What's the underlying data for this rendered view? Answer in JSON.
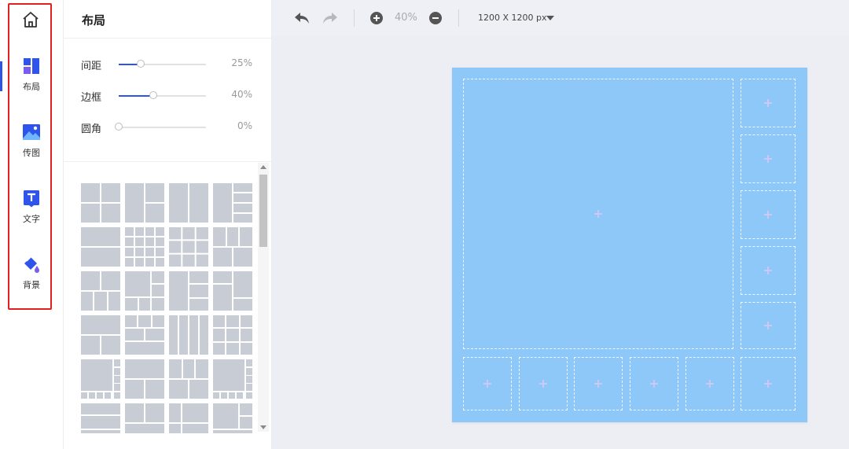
{
  "rail": {
    "home_icon": "home-icon",
    "items": [
      {
        "id": "layout",
        "label": "布局",
        "icon": "layout-icon",
        "active": true
      },
      {
        "id": "upload",
        "label": "传图",
        "icon": "image-upload-icon",
        "active": false
      },
      {
        "id": "text",
        "label": "文字",
        "icon": "text-icon",
        "active": false
      },
      {
        "id": "background",
        "label": "背景",
        "icon": "paint-bucket-icon",
        "active": false
      }
    ],
    "highlight_color": "#e0201e",
    "accent_color": "#2f54eb"
  },
  "panel": {
    "title": "布局",
    "sliders": [
      {
        "id": "spacing",
        "label": "间距",
        "value_text": "25%",
        "value": 25
      },
      {
        "id": "border",
        "label": "边框",
        "value_text": "40%",
        "value": 40
      },
      {
        "id": "radius",
        "label": "圆角",
        "value_text": "0%",
        "value": 0
      }
    ],
    "template_count_visible": 24,
    "tile_color": "#c8ccd4"
  },
  "toolbar": {
    "undo_icon": "undo-icon",
    "redo_icon": "redo-icon",
    "zoom_in_icon": "zoom-in-icon",
    "zoom_value": "40%",
    "zoom_out_icon": "zoom-out-icon",
    "canvas_size": "1200 X 1200 px",
    "size_dropdown_icon": "caret-down-icon"
  },
  "canvas": {
    "background": "#8dc8f8",
    "slot_count": 12,
    "slot_icon": "plus-icon"
  }
}
